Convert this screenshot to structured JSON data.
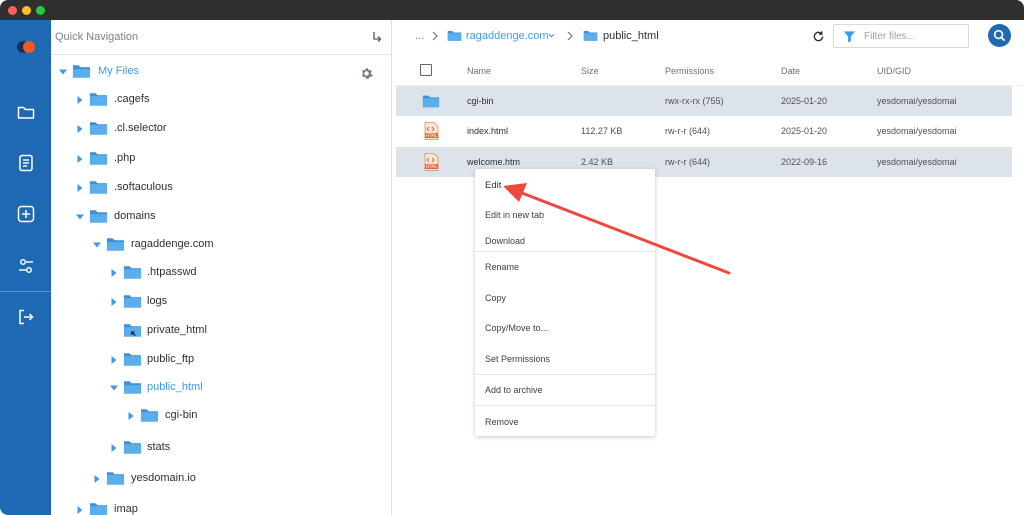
{
  "quick_nav": {
    "title": "Quick Navigation"
  },
  "tree": {
    "root": "My Files",
    "items": [
      {
        "label": ".cagefs"
      },
      {
        "label": ".cl.selector"
      },
      {
        "label": ".php"
      },
      {
        "label": ".softaculous"
      },
      {
        "label": "domains"
      },
      {
        "label": "ragaddenge.com"
      },
      {
        "label": ".htpasswd"
      },
      {
        "label": "logs"
      },
      {
        "label": "private_html"
      },
      {
        "label": "public_ftp"
      },
      {
        "label": "public_html"
      },
      {
        "label": "cgi-bin"
      },
      {
        "label": "stats"
      },
      {
        "label": "yesdomain.io"
      },
      {
        "label": "imap"
      }
    ]
  },
  "breadcrumb": {
    "ellipsis": "...",
    "domain": "ragaddenge.com",
    "current": "public_html"
  },
  "filter": {
    "placeholder": "Filter files..."
  },
  "table": {
    "columns": {
      "name": "Name",
      "size": "Size",
      "permissions": "Permissions",
      "date": "Date",
      "uid": "UID/GID"
    },
    "rows": [
      {
        "name": "cgi-bin",
        "size": "",
        "permissions": "rwx-rx-rx (755)",
        "date": "2025-01-20",
        "uid": "yesdomai/yesdomai"
      },
      {
        "name": "index.html",
        "size": "112.27 KB",
        "permissions": "rw-r-r (644)",
        "date": "2025-01-20",
        "uid": "yesdomai/yesdomai"
      },
      {
        "name": "welcome.htm",
        "size": "2.42 KB",
        "permissions": "rw-r-r (644)",
        "date": "2022-09-16",
        "uid": "yesdomai/yesdomai"
      }
    ]
  },
  "context_menu": {
    "items": [
      {
        "label": "Edit"
      },
      {
        "label": "Edit in new tab"
      },
      {
        "label": "Download"
      },
      {
        "label": "Rename"
      },
      {
        "label": "Copy"
      },
      {
        "label": "Copy/Move to..."
      },
      {
        "label": "Set Permissions"
      },
      {
        "label": "Add to archive"
      },
      {
        "label": "Remove"
      }
    ]
  },
  "file_badge": "HTML",
  "colors": {
    "rail": "#1f69b3",
    "folder": "#5aaeea",
    "accent": "#3d9ae8",
    "arrow": "#f0483e",
    "selected": "#dde3ea"
  }
}
